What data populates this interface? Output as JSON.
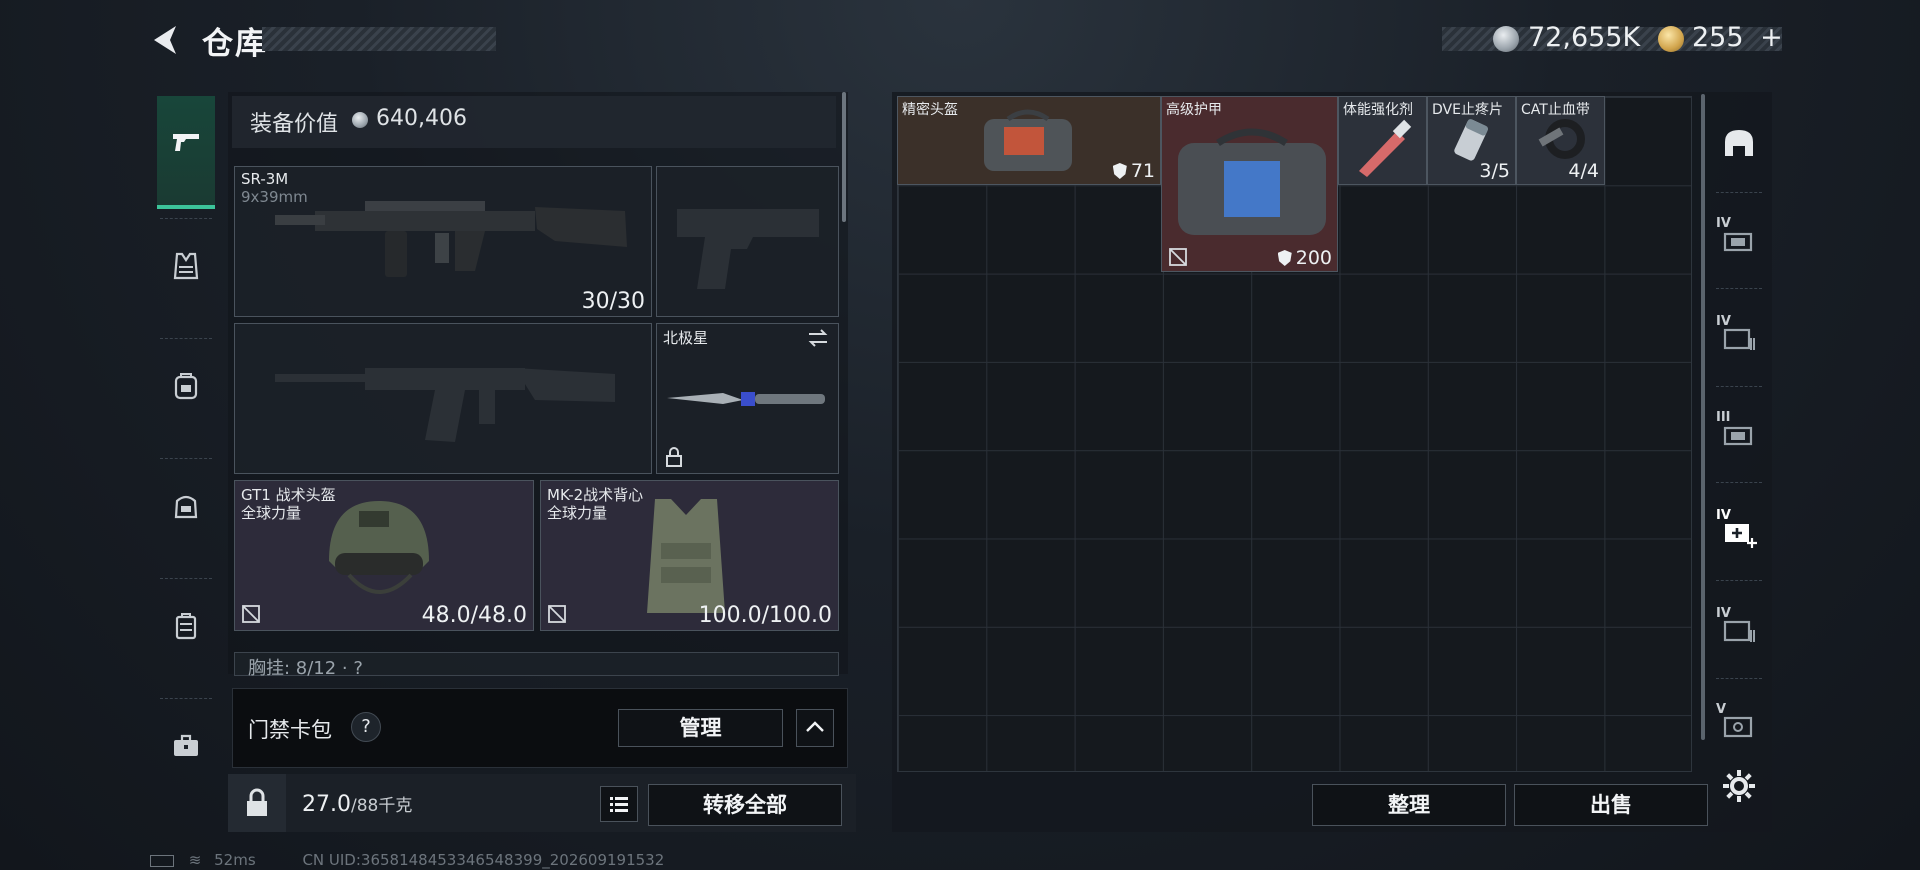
{
  "header": {
    "title": "仓库",
    "currency_silver": "72,655K",
    "currency_gold": "255",
    "currency_add": "+"
  },
  "rail": {
    "items": [
      {
        "icon": "pistol-icon",
        "active": true
      },
      {
        "icon": "vest-icon",
        "active": false
      },
      {
        "icon": "backpack-icon",
        "active": false
      },
      {
        "icon": "pouch-icon",
        "active": false
      },
      {
        "icon": "case-icon",
        "active": false
      },
      {
        "icon": "toolbox-icon",
        "active": false
      }
    ]
  },
  "equipment": {
    "value_label": "装备价值",
    "value": "640,406",
    "primary": {
      "name": "SR-3M",
      "caliber": "9x39mm",
      "ammo": "30/30"
    },
    "melee": {
      "name": "北极星"
    },
    "helmet": {
      "name": "GT1 战术头盔",
      "brand": "全球力量",
      "durability": "48.0/48.0"
    },
    "armor": {
      "name": "MK-2战术背心",
      "brand": "全球力量",
      "durability": "100.0/100.0"
    },
    "rig_label": "胸挂: 8/12 · ?"
  },
  "keycard": {
    "label": "门禁卡包",
    "help": "?",
    "manage": "管理"
  },
  "footer_left": {
    "weight": "27.0",
    "weight_max": "/88千克",
    "transfer_all": "转移全部"
  },
  "status": {
    "ping": "52ms",
    "uid": "CN UID:3658148453346548399_202609191532"
  },
  "storage": {
    "items": [
      {
        "name": "精密头盔",
        "value": "71"
      },
      {
        "name": "高级护甲",
        "value": "200"
      },
      {
        "name": "体能强化剂",
        "value": ""
      },
      {
        "name": "DVE止疼片",
        "value": "3/5"
      },
      {
        "name": "CAT止血带",
        "value": "4/4"
      }
    ],
    "sort": "整理",
    "sell": "出售"
  },
  "storage_tabs": [
    {
      "icon": "helmet-outline-icon",
      "level": ""
    },
    {
      "icon": "folder-card-icon",
      "level": "IV"
    },
    {
      "icon": "folder-stack-icon",
      "level": "IV"
    },
    {
      "icon": "folder-card-icon",
      "level": "III"
    },
    {
      "icon": "add-box-icon",
      "level": "IV"
    },
    {
      "icon": "folder-stack-icon",
      "level": "IV"
    },
    {
      "icon": "safe-icon",
      "level": "V"
    },
    {
      "icon": "gear-icon",
      "level": ""
    }
  ],
  "colors": {
    "accent": "#3cc49a",
    "armor_slot": "#4a2b2e",
    "helmet_slot": "#3b3029"
  }
}
